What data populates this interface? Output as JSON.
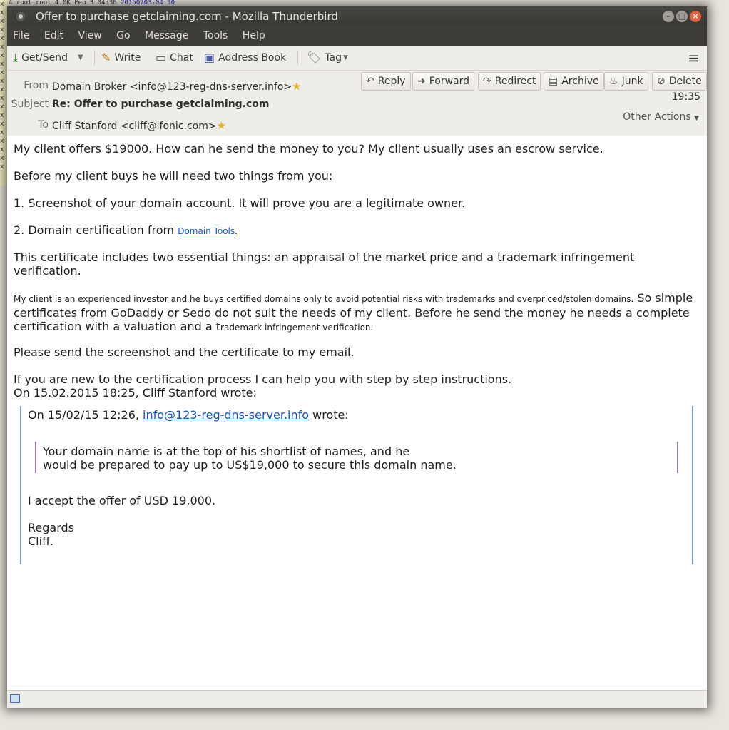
{
  "background": {
    "top_line": "4 root root 4.0K Feb  3 04:30",
    "top_timestamp": "20150203-04:30",
    "strip_lines": [
      "x",
      "x",
      "x",
      "x",
      "x",
      "x",
      "x",
      "x",
      "x",
      "x",
      "x",
      "x",
      "x",
      "x",
      "x",
      "x",
      "x",
      "x",
      "x",
      "x"
    ]
  },
  "window": {
    "title": "Offer to purchase getclaiming.com - Mozilla Thunderbird"
  },
  "menu": {
    "file": "File",
    "edit": "Edit",
    "view": "View",
    "go": "Go",
    "message": "Message",
    "tools": "Tools",
    "help": "Help"
  },
  "toolbar": {
    "getsend": "Get/Send",
    "write": "Write",
    "chat": "Chat",
    "address_book": "Address Book",
    "tag": "Tag"
  },
  "header": {
    "from_label": "From",
    "from_value": "Domain Broker <info@123-reg-dns-server.info>",
    "subject_label": "Subject",
    "subject_value": "Re: Offer to purchase getclaiming.com",
    "to_label": "To",
    "to_value": "Cliff Stanford <cliff@ifonic.com>",
    "time": "19:35",
    "other_actions": "Other Actions",
    "actions": {
      "reply": "Reply",
      "forward": "Forward",
      "redirect": "Redirect",
      "archive": "Archive",
      "junk": "Junk",
      "delete": "Delete"
    }
  },
  "message": {
    "p1": "My client offers $19000. How can he send the money to you? My client usually uses an escrow service.",
    "p2": "Before my client buys he will need two things from you:",
    "p3": "1. Screenshot of your domain account. It will prove you are a legitimate owner.",
    "p4_pre": "2. Domain certification from ",
    "p4_link": "Domain Tools",
    "p4_post": ".",
    "p5": "This certificate includes two essential things:  an appraisal of the market price and a trademark infringement verification.",
    "p6_small": "My client  is an experienced investor and he buys certified domains only to avoid potential risks with trademarks and overpriced/stolen domains.",
    "p6_large": " So simple certificates from GoDaddy or Sedo do not suit the needs of my client. Before he send the money he needs a complete certification with a valuation and  a t",
    "p6_small_end": "rademark infringement verification.",
    "p7": "Please send the screenshot and the certificate to my email.",
    "p8": "If you are new to the certification process I can help you with step by step instructions.",
    "p9": "On 15.02.2015 18:25, Cliff Stanford wrote:",
    "quote": {
      "intro_pre": "On 15/02/15 12:26, ",
      "intro_link": "info@123-reg-dns-server.info",
      "intro_post": " wrote:",
      "inner_line1": "Your domain name is at the top of his shortlist of names, and he",
      "inner_line2": "would be prepared to pay up to US$19,000 to secure this domain name.",
      "accept": "I accept the offer of USD 19,000.",
      "regards": "Regards",
      "signature": "Cliff."
    }
  }
}
